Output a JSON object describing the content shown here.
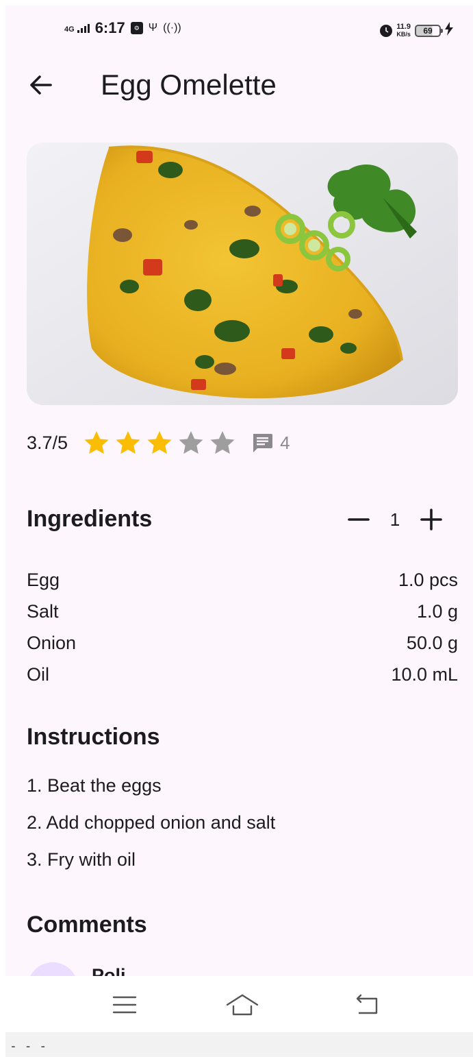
{
  "status_bar": {
    "network": "4G",
    "time": "6:17",
    "speed_value": "11.9",
    "speed_unit": "KB/s",
    "battery": "69",
    "icons": [
      "signal-icon",
      "usb-settings-icon",
      "usb-icon",
      "hotspot-icon",
      "alarm-icon",
      "battery-icon",
      "charging-icon"
    ]
  },
  "app_bar": {
    "title": "Egg Omelette",
    "back_icon": "arrow-back-icon"
  },
  "rating": {
    "text": "3.7/5",
    "value": 3.7,
    "max": 5,
    "filled_stars": 3,
    "comment_count": "4",
    "star_color": "#fbbc04",
    "empty_star_color": "#9e9e9e"
  },
  "ingredients": {
    "title": "Ingredients",
    "servings": "1",
    "items": [
      {
        "name": "Egg",
        "amount": "1.0 pcs"
      },
      {
        "name": "Salt",
        "amount": "1.0 g"
      },
      {
        "name": "Onion",
        "amount": "50.0 g"
      },
      {
        "name": "Oil",
        "amount": "10.0 mL"
      }
    ]
  },
  "instructions": {
    "title": "Instructions",
    "steps": [
      "1. Beat the eggs",
      "2. Add chopped onion and salt",
      "3. Fry with oil"
    ]
  },
  "comments": {
    "title": "Comments",
    "first_author": "Poli"
  },
  "nav_bar": {
    "icons": [
      "menu-icon",
      "home-icon",
      "back-icon"
    ]
  },
  "bottom_strip": "- - -"
}
